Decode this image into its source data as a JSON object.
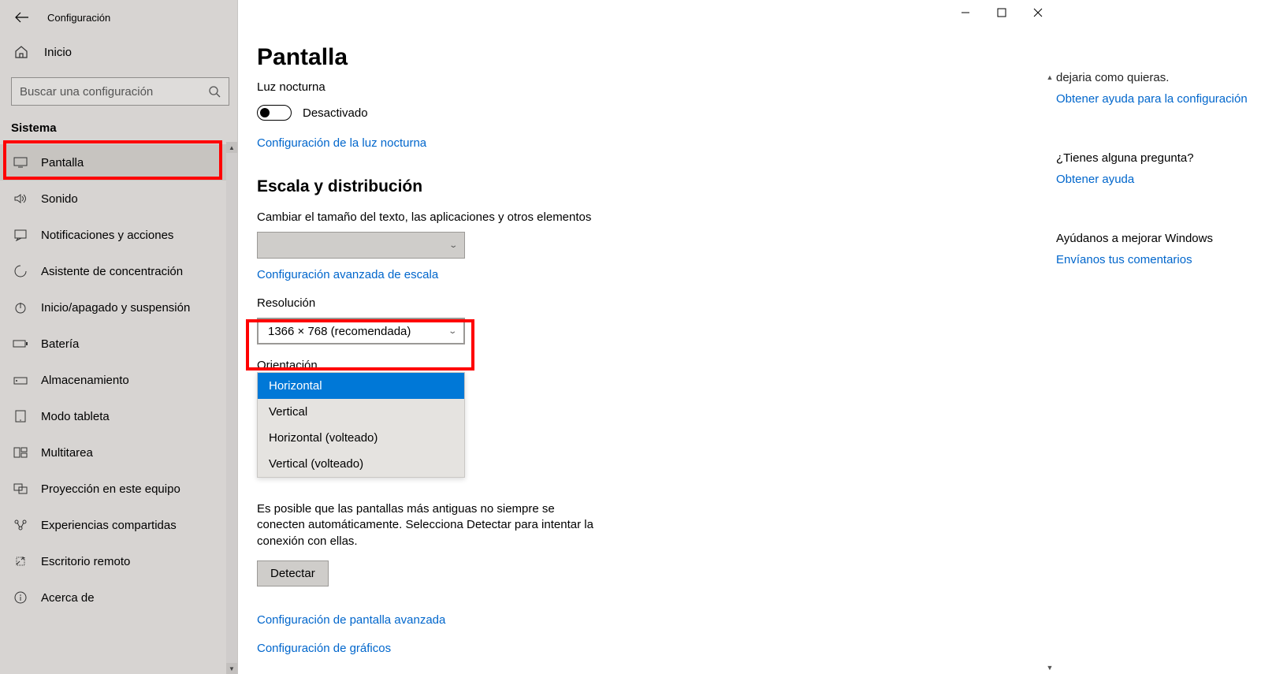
{
  "sidebar": {
    "title": "Configuración",
    "home": "Inicio",
    "search_placeholder": "Buscar una configuración",
    "section": "Sistema",
    "items": [
      {
        "label": "Pantalla"
      },
      {
        "label": "Sonido"
      },
      {
        "label": "Notificaciones y acciones"
      },
      {
        "label": "Asistente de concentración"
      },
      {
        "label": "Inicio/apagado y suspensión"
      },
      {
        "label": "Batería"
      },
      {
        "label": "Almacenamiento"
      },
      {
        "label": "Modo tableta"
      },
      {
        "label": "Multitarea"
      },
      {
        "label": "Proyección en este equipo"
      },
      {
        "label": "Experiencias compartidas"
      },
      {
        "label": "Escritorio remoto"
      },
      {
        "label": "Acerca de"
      }
    ]
  },
  "main": {
    "title": "Pantalla",
    "night_light_label": "Luz nocturna",
    "night_light_state": "Desactivado",
    "night_light_settings": "Configuración de la luz nocturna",
    "scale_header": "Escala y distribución",
    "text_size_label": "Cambiar el tamaño del texto, las aplicaciones y otros elementos",
    "advanced_scale": "Configuración avanzada de escala",
    "resolution_label": "Resolución",
    "resolution_value": "1366 × 768 (recomendada)",
    "orientation_label": "Orientación",
    "orientation_options": [
      "Horizontal",
      "Vertical",
      "Horizontal (volteado)",
      "Vertical (volteado)"
    ],
    "orientation_selected": "Horizontal",
    "detect_note": "Es posible que las pantallas más antiguas no siempre se conecten automáticamente. Selecciona Detectar para intentar la conexión con ellas.",
    "detect_btn": "Detectar",
    "advanced_display": "Configuración de pantalla avanzada",
    "graphics_settings": "Configuración de gráficos"
  },
  "aside": {
    "partial_line": "dejaria como quieras.",
    "help_config": "Obtener ayuda para la configuración",
    "question_title": "¿Tienes alguna pregunta?",
    "get_help": "Obtener ayuda",
    "improve_title": "Ayúdanos a mejorar Windows",
    "send_feedback": "Envíanos tus comentarios"
  }
}
